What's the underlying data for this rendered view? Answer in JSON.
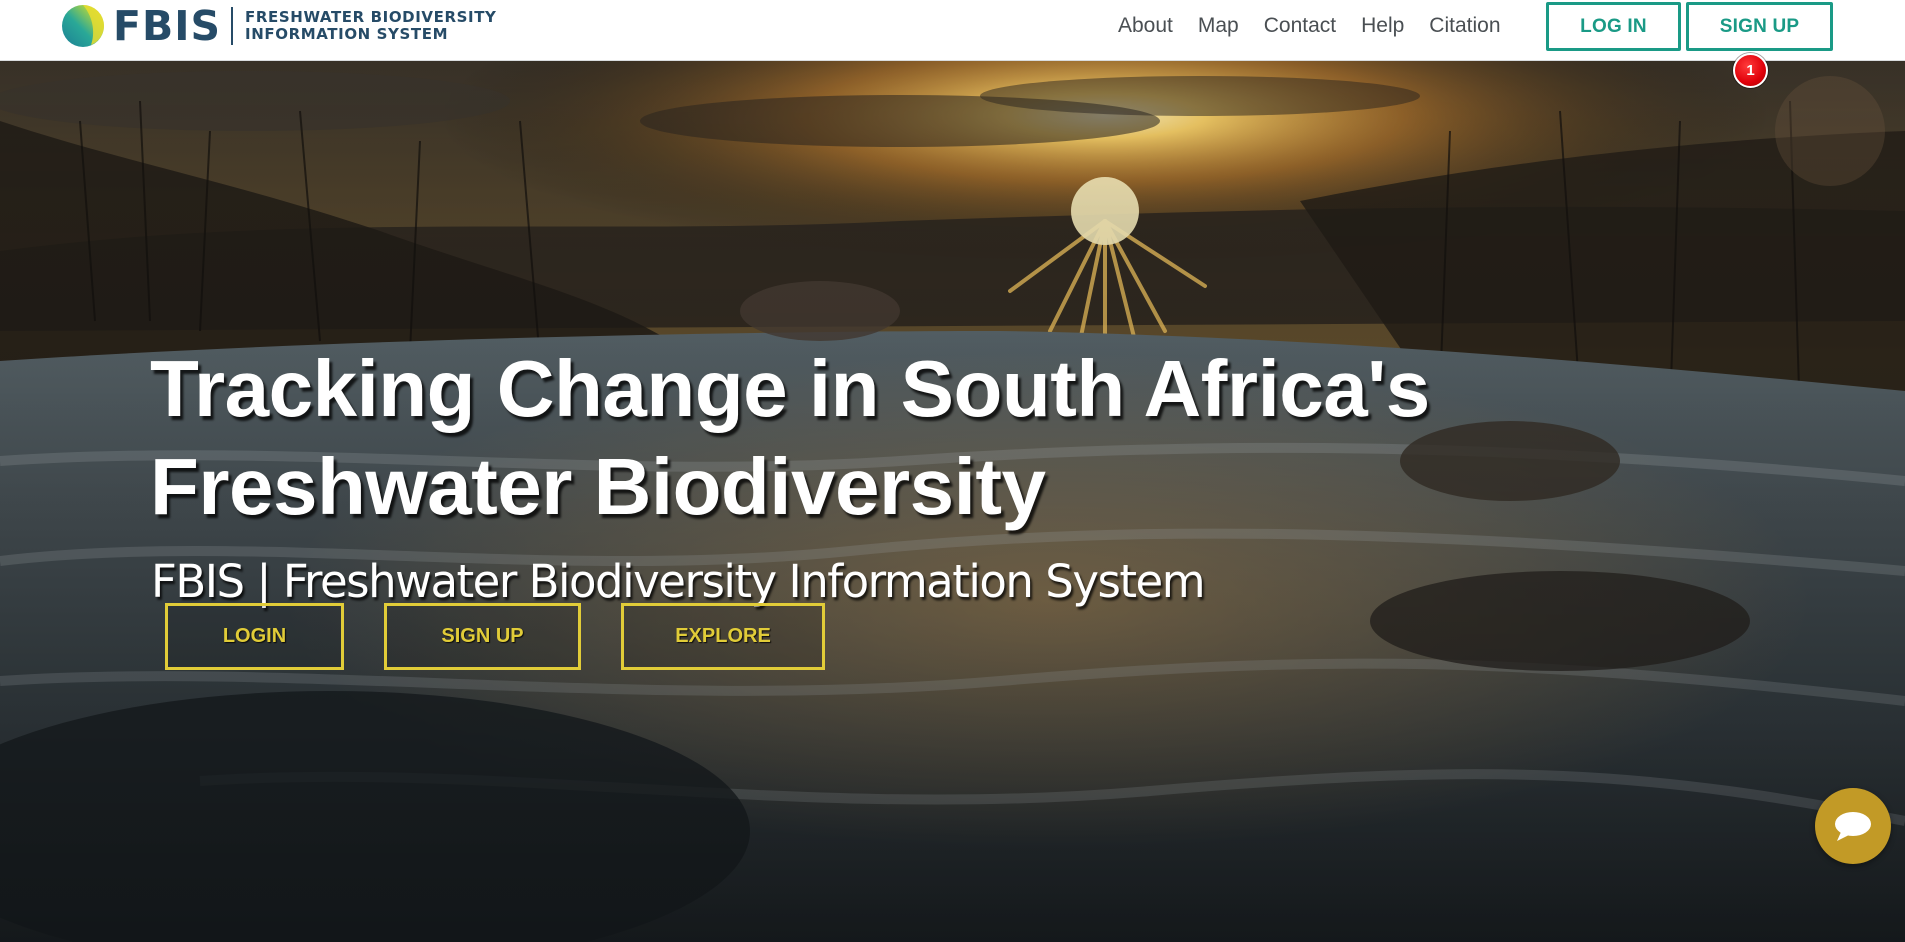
{
  "brand": {
    "mark": "FBIS",
    "subtitle_line1": "FRESHWATER BIODIVERSITY",
    "subtitle_line2": "INFORMATION SYSTEM",
    "logo_icon": "fbis-globe-logo-icon"
  },
  "nav": {
    "links": [
      "About",
      "Map",
      "Contact",
      "Help",
      "Citation"
    ],
    "login_label": "LOG IN",
    "signup_label": "SIGN UP",
    "notification_count": "1"
  },
  "hero": {
    "title": "Tracking Change in South Africa's Freshwater Biodiversity",
    "subtitle": "FBIS | Freshwater Biodiversity Information System",
    "buttons": {
      "login": "LOGIN",
      "signup": "SIGN UP",
      "explore": "EXPLORE"
    },
    "background": "river-rapids-at-sunset-photo"
  },
  "chat": {
    "icon": "chat-bubble-icon"
  },
  "colors": {
    "brand_navy": "#264b67",
    "nav_accent": "#1a9a86",
    "hero_button_yellow": "#e1cc38",
    "chat_button": "#c29a26",
    "badge_red": "#e0000a"
  }
}
